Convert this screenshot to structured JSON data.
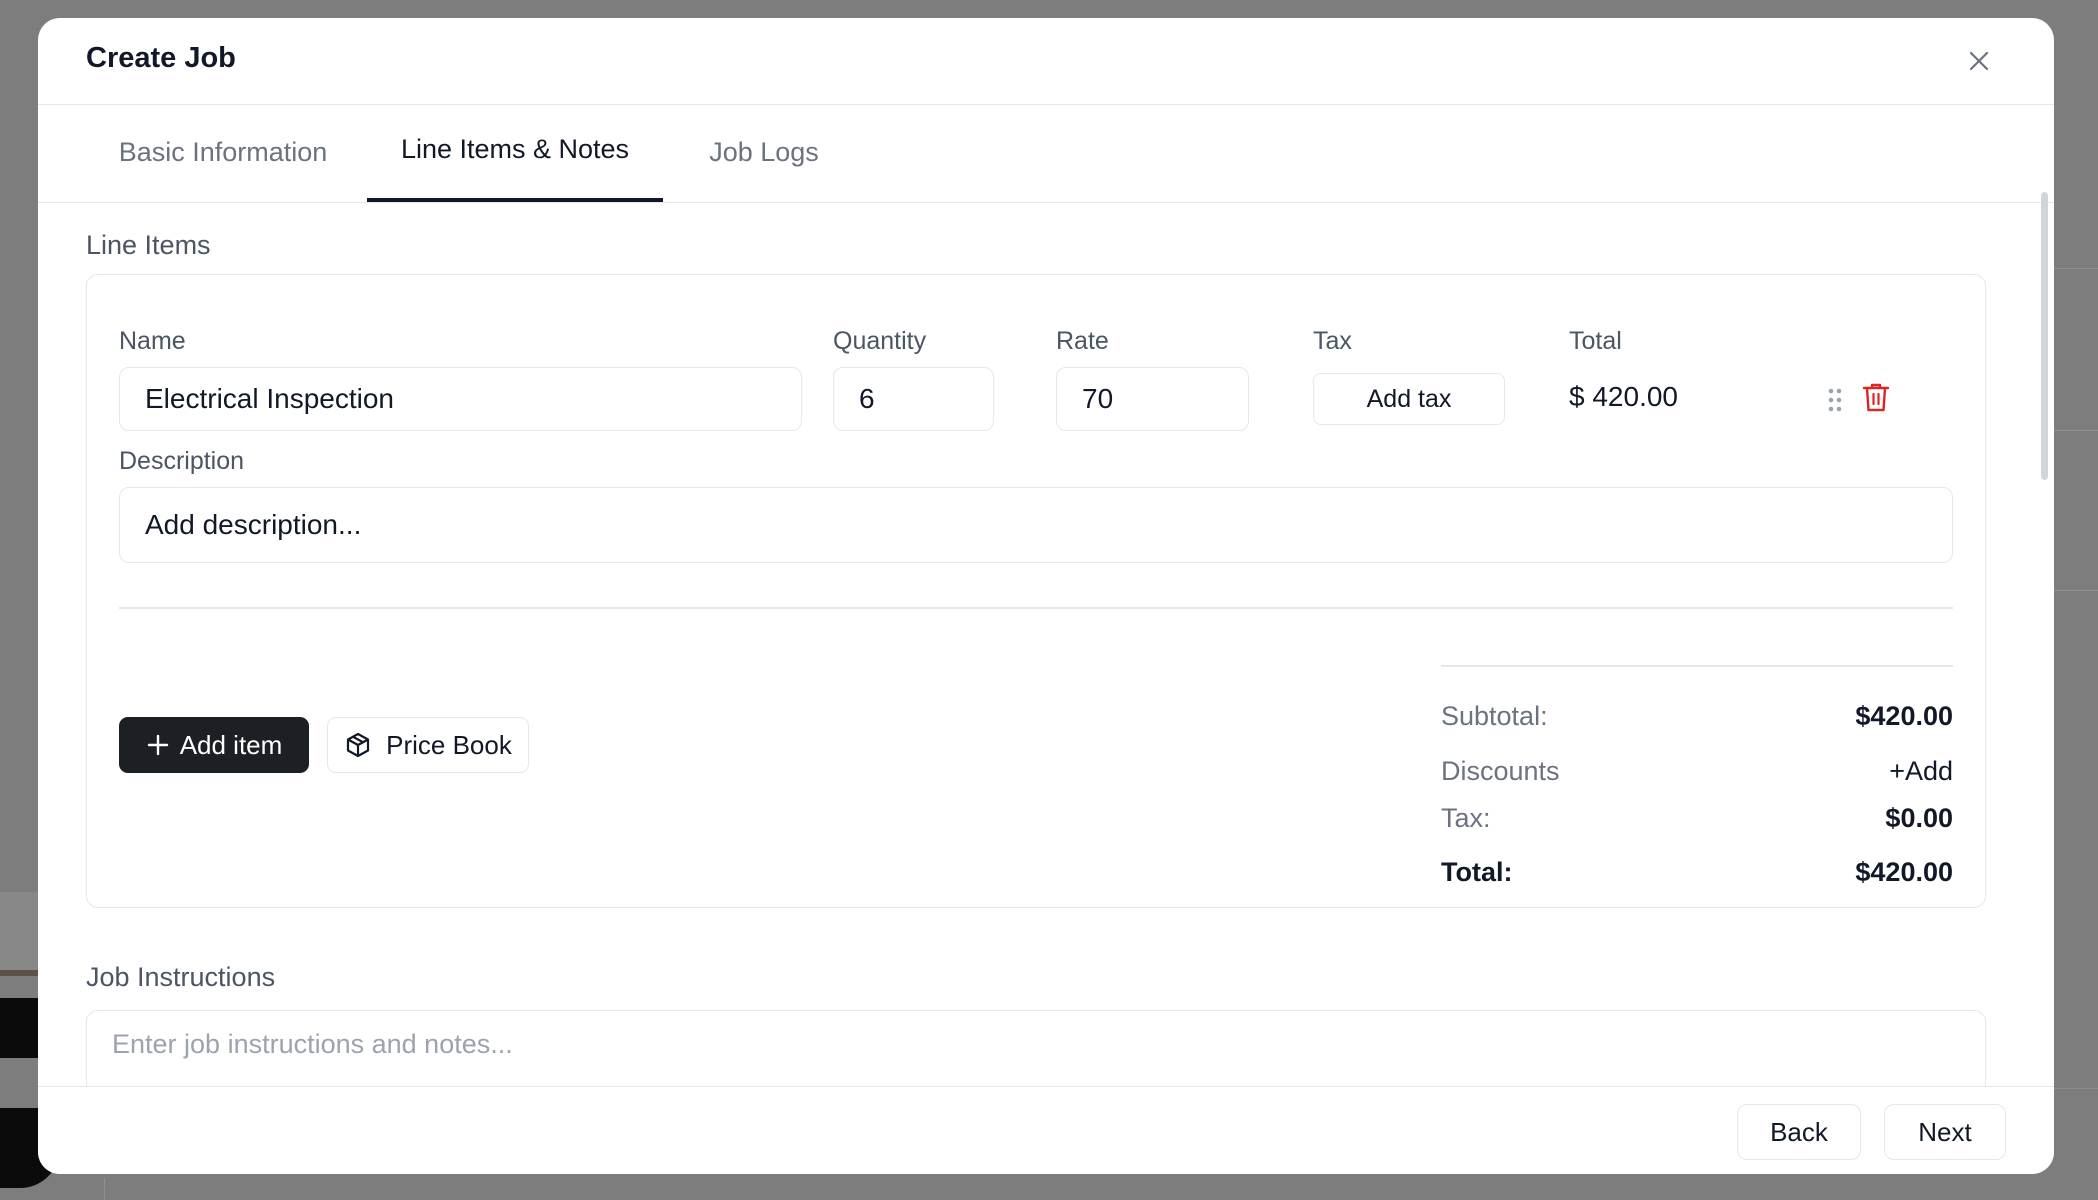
{
  "modal": {
    "title": "Create Job",
    "close_icon": "close-icon"
  },
  "tabs": [
    {
      "label": "Basic Information",
      "active": false
    },
    {
      "label": "Line Items & Notes",
      "active": true
    },
    {
      "label": "Job Logs",
      "active": false
    }
  ],
  "line_items": {
    "section_label": "Line Items",
    "columns": {
      "name": "Name",
      "quantity": "Quantity",
      "rate": "Rate",
      "tax": "Tax",
      "total": "Total"
    },
    "items": [
      {
        "name": "Electrical Inspection",
        "quantity": "6",
        "rate": "70",
        "tax_button": "Add tax",
        "total": "$ 420.00",
        "description_label": "Description",
        "description_placeholder": "Add description..."
      }
    ],
    "add_item_label": "Add item",
    "price_book_label": "Price Book"
  },
  "summary": {
    "subtotal_label": "Subtotal:",
    "subtotal_value": "$420.00",
    "discounts_label": "Discounts",
    "discounts_action": "+Add",
    "tax_label": "Tax:",
    "tax_value": "$0.00",
    "total_label": "Total:",
    "total_value": "$420.00"
  },
  "job_instructions": {
    "section_label": "Job Instructions",
    "placeholder": "Enter job instructions and notes..."
  },
  "footer": {
    "back_label": "Back",
    "next_label": "Next"
  },
  "colors": {
    "primary_dark": "#1c1f24",
    "danger": "#dc2626",
    "border": "#e5e7eb"
  }
}
